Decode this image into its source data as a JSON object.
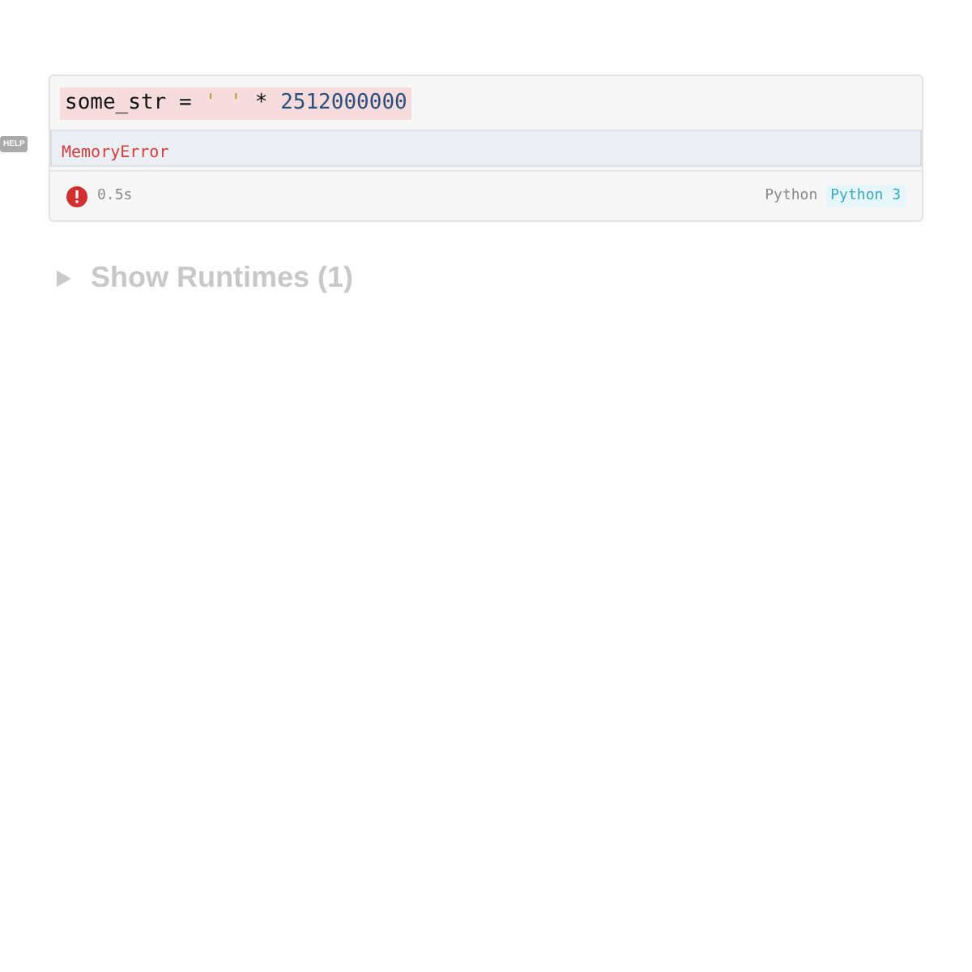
{
  "help_badge": "HELP",
  "cell": {
    "code_tokens": [
      {
        "text": "some_str",
        "kind": "name"
      },
      {
        "text": "=",
        "kind": "operator"
      },
      {
        "text": "' '",
        "kind": "string"
      },
      {
        "text": "*",
        "kind": "operator"
      },
      {
        "text": "2512000000",
        "kind": "number"
      }
    ],
    "output": "MemoryError",
    "failed": true,
    "duration": "0.5s",
    "language": "Python",
    "kernel": "Python 3"
  },
  "runtimes": {
    "label": "Show Runtimes (1)",
    "expanded": false
  }
}
